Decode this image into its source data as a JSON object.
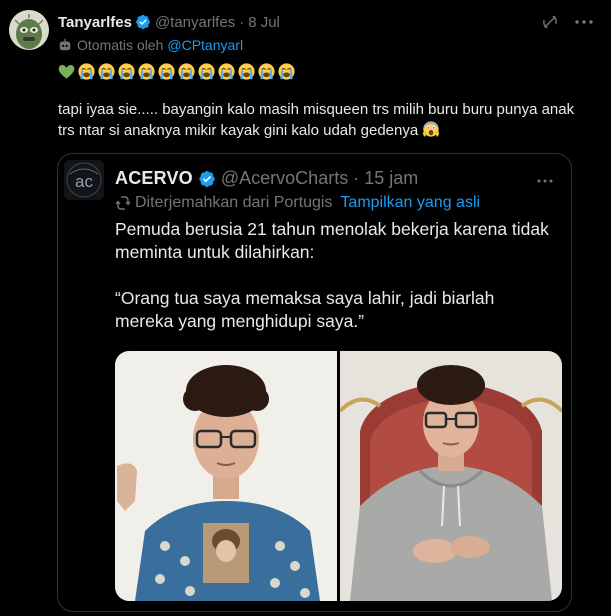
{
  "tweet": {
    "display_name": "Tanyarlfes",
    "handle": "@tanyarlfes",
    "separator": "·",
    "date": "8 Jul",
    "auto_prefix": "Otomatis oleh",
    "auto_account": "@CPtanyarl",
    "reaction_emojis": [
      "green-heart",
      "loudly-crying",
      "loudly-crying",
      "loudly-crying",
      "loudly-crying",
      "loudly-crying",
      "loudly-crying",
      "loudly-crying",
      "loudly-crying",
      "loudly-crying",
      "loudly-crying",
      "loudly-crying"
    ],
    "text": "tapi iyaa sie..... bayangin kalo masih misqueen trs milih buru buru punya anak trs ntar si anaknya mikir kayak gini kalo udah gedenya",
    "text_trailing_emoji": "screaming-face"
  },
  "quote": {
    "display_name": "ACERVO",
    "handle": "@AcervoCharts",
    "separator": "·",
    "time": "15 jam",
    "translated_from": "Diterjemahkan dari Portugis",
    "show_original": "Tampilkan yang asli",
    "paragraph1": "Pemuda berusia 21 tahun menolak bekerja karena tidak meminta untuk dilahirkan:",
    "paragraph2": "“Orang tua saya memaksa saya lahir, jadi biarlah mereka yang menghidupi saya.”",
    "avatar_text": "ac"
  },
  "colors": {
    "background": "#000000",
    "text": "#e7e9ea",
    "secondary": "#71767b",
    "accent": "#1d9bf0",
    "border": "#2f3336"
  },
  "icons": {
    "verified": "verified-badge-icon",
    "grok": "grok-icon",
    "more": "more-horizontal-icon",
    "bot": "automated-account-icon",
    "translate": "translate-icon"
  }
}
